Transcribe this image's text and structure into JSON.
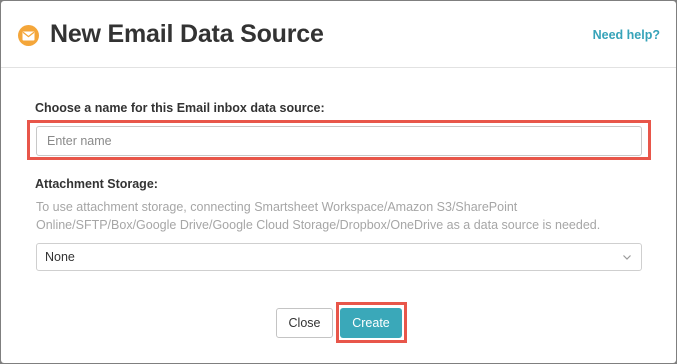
{
  "dialog": {
    "title": "New Email Data Source",
    "title_icon": "envelope-icon",
    "help_link": "Need help?"
  },
  "name_field": {
    "label": "Choose a name for this Email inbox data source:",
    "placeholder": "Enter name",
    "value": ""
  },
  "attachment_storage": {
    "label": "Attachment Storage:",
    "help_text": "To use attachment storage, connecting Smartsheet Workspace/Amazon S3/SharePoint Online/SFTP/Box/Google Drive/Google Cloud Storage/Dropbox/OneDrive as a data source is needed.",
    "selected": "None"
  },
  "buttons": {
    "close": "Close",
    "create": "Create"
  },
  "colors": {
    "accent": "#3aa8b9",
    "icon": "#f4a63a",
    "highlight": "#e8564a"
  }
}
